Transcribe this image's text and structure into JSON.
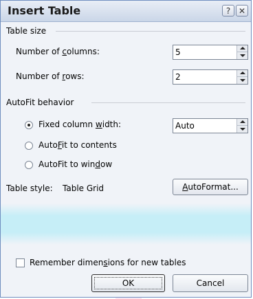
{
  "window": {
    "title": "Insert Table",
    "help_glyph": "?",
    "close_glyph": "✕"
  },
  "table_size": {
    "heading": "Table size",
    "columns": {
      "label_pre": "Number of ",
      "label_u": "c",
      "label_post": "olumns:",
      "value": "5"
    },
    "rows": {
      "label_pre": "Number of ",
      "label_u": "r",
      "label_post": "ows:",
      "value": "2"
    }
  },
  "autofit": {
    "heading": "AutoFit behavior",
    "fixed": {
      "label_pre": "Fixed column ",
      "label_u": "w",
      "label_post": "idth:",
      "value": "Auto",
      "selected": true
    },
    "contents": {
      "label_pre": "Auto",
      "label_u": "F",
      "label_post": "it to contents",
      "selected": false
    },
    "window": {
      "label_pre": "AutoFit to win",
      "label_u": "d",
      "label_post": "ow",
      "selected": false
    }
  },
  "table_style": {
    "label": "Table style:",
    "value": "Table Grid",
    "autoformat_u": "A",
    "autoformat_rest": "utoFormat..."
  },
  "remember": {
    "label_pre": "Remember dimen",
    "label_u": "s",
    "label_post": "ions for new tables",
    "checked": false
  },
  "buttons": {
    "ok": "OK",
    "cancel": "Cancel"
  }
}
